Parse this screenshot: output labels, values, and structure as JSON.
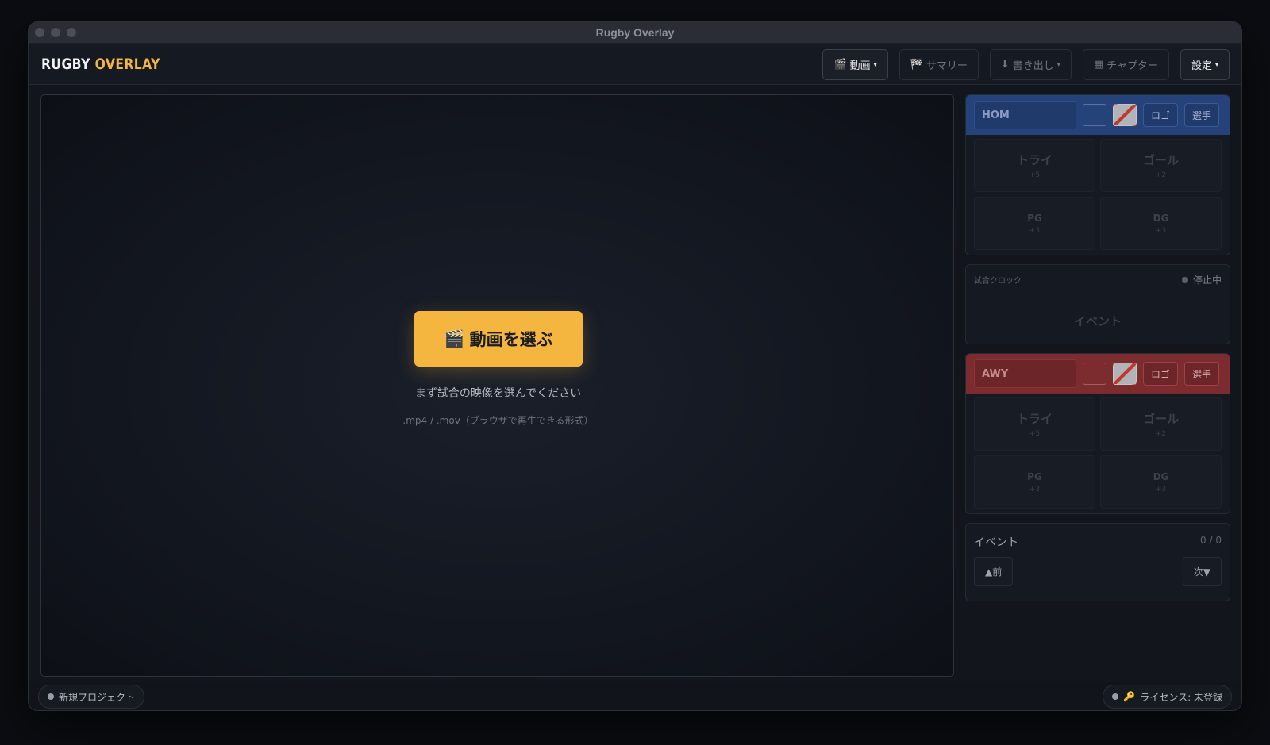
{
  "window": {
    "title": "Rugby Overlay"
  },
  "app": {
    "logo_part1": "RUGBY",
    "logo_part2": "OVERLAY"
  },
  "toolbar": {
    "video": {
      "icon": "🎬",
      "label": "動画"
    },
    "summary": {
      "icon": "🏁",
      "label": "サマリー"
    },
    "export": {
      "icon": "⬇",
      "label": "書き出し"
    },
    "chapter": {
      "icon": "▦",
      "label": "チャプター"
    },
    "settings": {
      "label": "設定"
    }
  },
  "video_area": {
    "pick_button": {
      "icon": "🎬",
      "label": "動画を選ぶ"
    },
    "hint": "まず試合の映像を選んでください",
    "formats": ".mp4 / .mov（ブラウザで再生できる形式）"
  },
  "home_team": {
    "name": "HOM",
    "logo_label": "ロゴ",
    "players_label": "選手",
    "color": "#26427a",
    "scores": [
      {
        "label": "トライ",
        "points": "+5"
      },
      {
        "label": "ゴール",
        "points": "+2"
      },
      {
        "label": "PG",
        "points": "+3"
      },
      {
        "label": "DG",
        "points": "+3"
      }
    ]
  },
  "clock": {
    "label": "試合クロック",
    "status": "停止中",
    "event": "イベント"
  },
  "away_team": {
    "name": "AWY",
    "logo_label": "ロゴ",
    "players_label": "選手",
    "color": "#7c2b2e",
    "scores": [
      {
        "label": "トライ",
        "points": "+5"
      },
      {
        "label": "ゴール",
        "points": "+2"
      },
      {
        "label": "PG",
        "points": "+3"
      },
      {
        "label": "DG",
        "points": "+3"
      }
    ]
  },
  "events": {
    "label": "イベント",
    "count": "0 / 0",
    "prev": "▲前",
    "next": "次▼"
  },
  "status_bar": {
    "project": "新規プロジェクト",
    "license_icon": "🔑",
    "license": "ライセンス: 未登録"
  },
  "colors": {
    "accent": "#f4b63f",
    "home": "#26427a",
    "away": "#7c2b2e"
  }
}
